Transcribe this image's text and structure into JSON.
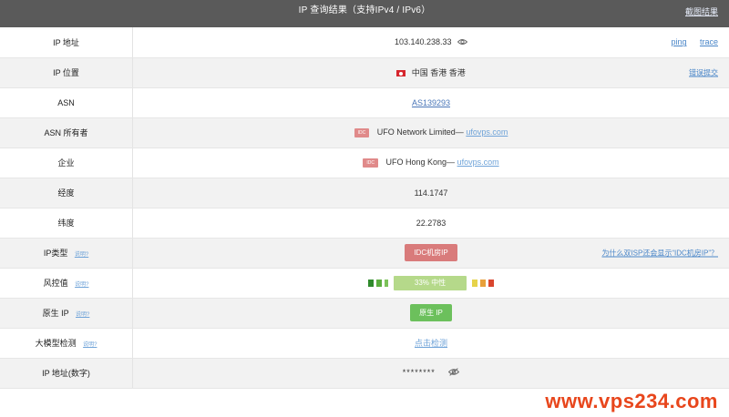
{
  "header": {
    "title": "IP 查询结果（支持IPv4 / IPv6）",
    "close_label": "截图结果"
  },
  "rows": {
    "ip": {
      "label": "IP 地址",
      "value": "103.140.238.33",
      "ping": "ping",
      "trace": "trace"
    },
    "location": {
      "label": "IP 位置",
      "value": "中国 香港 香港",
      "report": "错误提交"
    },
    "asn": {
      "label": "ASN",
      "value": "AS139293"
    },
    "asn_owner": {
      "label": "ASN 所有者",
      "tag": "IDC",
      "name": "UFO Network Limited—",
      "domain": "ufovps.com"
    },
    "company": {
      "label": "企业",
      "tag": "IDC",
      "name": "UFO Hong Kong—",
      "domain": "ufovps.com"
    },
    "longitude": {
      "label": "经度",
      "value": "114.1747"
    },
    "latitude": {
      "label": "纬度",
      "value": "22.2783"
    },
    "ip_type": {
      "label": "IP类型",
      "help": "说明?",
      "badge": "IDC机房IP",
      "why": "为什么双ISP还会显示“IDC机房IP”？"
    },
    "risk": {
      "label": "风控值",
      "help": "说明?",
      "value": "33%  中性",
      "level": 0.33
    },
    "native": {
      "label": "原生 IP",
      "help": "说明?",
      "badge": "原生 IP"
    },
    "llm": {
      "label": "大模型检测",
      "help": "说明?",
      "action": "点击检测"
    },
    "ip_numeric": {
      "label": "IP 地址(数字)",
      "value": "********"
    }
  },
  "colors": {
    "header_bg": "#5a5a5a",
    "idc_badge": "#d97b7b",
    "native_badge": "#6cc05c",
    "risk_bar": "#b5d98a",
    "watermark": "#e8461c"
  },
  "icons": [
    "eye-icon",
    "eye-off-icon",
    "hk-flag-icon"
  ],
  "watermark": "www.vps234.com"
}
